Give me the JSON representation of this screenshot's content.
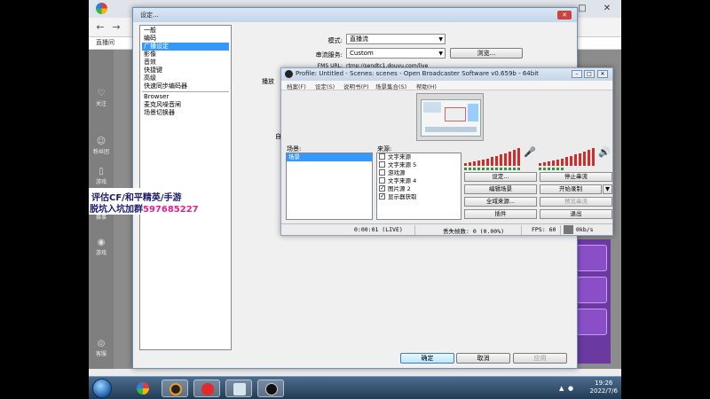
{
  "browser": {
    "bookmark": "直播间",
    "window_controls": {
      "min": "—",
      "max": "□",
      "close": "✕"
    }
  },
  "site_sidebar": [
    {
      "icon": "heart-icon",
      "label": "关注"
    },
    {
      "icon": "user-icon",
      "label": "粉丝团"
    },
    {
      "icon": "mouse-icon",
      "label": "游戏"
    },
    {
      "icon": "trophy-icon",
      "label": "赛事"
    },
    {
      "icon": "game-controller-icon",
      "label": "游戏"
    },
    {
      "icon": "headphones-icon",
      "label": "客服"
    }
  ],
  "ad": {
    "line1": "评估CF/和平精英/手游",
    "line2_prefix": "脱坑入坑加群",
    "line2_number": "597685227"
  },
  "settings": {
    "title": "设定...",
    "categories": [
      {
        "label": "一般",
        "selected": false
      },
      {
        "label": "编码",
        "selected": false
      },
      {
        "label": "广播设定",
        "selected": true
      },
      {
        "label": "影像",
        "selected": false
      },
      {
        "label": "音效",
        "selected": false
      },
      {
        "label": "快捷键",
        "selected": false
      },
      {
        "label": "高级",
        "selected": false
      }
    ],
    "categories_after_sep": [
      {
        "label": "快速同步编码器"
      },
      {
        "label": "Browser"
      },
      {
        "label": "麦克风噪音闸"
      },
      {
        "label": "场景切换器"
      }
    ],
    "mode_label": "模式:",
    "mode_value": "直播流",
    "service_label": "串流服务:",
    "service_value": "Custom",
    "browse_button": "浏览...",
    "fms_label": "FMS URL:",
    "fms_value": "rtmp://sendtc1.douyu.com/live",
    "side_label_1": "播放",
    "side_label_2": "自",
    "ok": "确定",
    "cancel": "取消",
    "apply": "应用"
  },
  "obs": {
    "title": "Profile: Untitled - Scenes: scenes - Open Broadcaster Software v0.659b - 64bit",
    "menu": [
      "档案(F)",
      "设定(S)",
      "说明书(P)",
      "场景集合(S)",
      "帮助(H)"
    ],
    "scenes_label": "场景:",
    "scenes": [
      {
        "label": "场景",
        "selected": true
      }
    ],
    "sources_label": "来源:",
    "sources": [
      {
        "label": "文字来源",
        "checked": false
      },
      {
        "label": "文字来源 5",
        "checked": false
      },
      {
        "label": "游戏源",
        "checked": false
      },
      {
        "label": "文字来源 4",
        "checked": false
      },
      {
        "label": "图片源 2",
        "checked": true
      },
      {
        "label": "显示器获取",
        "checked": true
      }
    ],
    "buttons": {
      "settings": "设定...",
      "stop_stream": "停止串流",
      "edit_scene": "编辑场景",
      "start_record": "开始录制",
      "global_sources": "全域来源...",
      "preview": "预览串流",
      "plugins": "插件",
      "exit": "退出"
    },
    "status": {
      "time": "0:00:01 (LIVE)",
      "dropped": "丢失帧数: 0 (0.00%)",
      "fps": "FPS: 60",
      "bitrate": "0kb/s"
    }
  },
  "taskbar": {
    "time": "19:26",
    "date": "2022/7/6"
  }
}
